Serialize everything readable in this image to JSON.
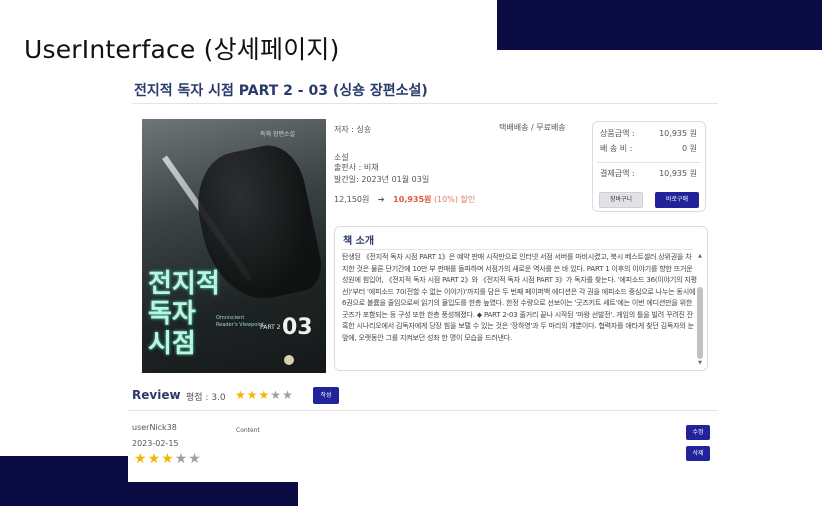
{
  "slide": {
    "title": "UserInterface (상세페이지)"
  },
  "book": {
    "title": "전지적 독자 시점 PART 2 - 03 (싱숑 장편소설)",
    "author_line": "저자 : 싱숑",
    "category": "소설",
    "publisher_line": "출판사 : 비채",
    "date_line": "발간일:  2023년 01월 03일",
    "shipping": "택배배송 / 무료배송",
    "original_price": "12,150원",
    "sale_price": "10,935원",
    "discount": "(10%) 할인"
  },
  "cover": {
    "top_text": "독해 장편소설",
    "title_lines": [
      "전지적",
      "독자",
      "시점"
    ],
    "english": "Omniscient Reader's Viewpoint",
    "part": "PART 2",
    "number": "03"
  },
  "summary": {
    "product_label": "상품금액 :",
    "product_value": "10,935 원",
    "shipping_label": "배 송 비 :",
    "shipping_value": "0 원",
    "total_label": "결제금액 :",
    "total_value": "10,935 원",
    "cart_button": "장바구니",
    "buy_button": "바로구매"
  },
  "intro": {
    "heading": "책 소개",
    "text": "탄생된 《전지적 독자 시점 PART 1》은 예약 판매 시작만으로 인터넷 서점 서버를 마비시켰고, 북시 베스트셀러 상위권을 차지한 것은 물론 단기간에 10만 부 판매를 돌파하며 서점가의 새로운 역사를 쓴 바 있다. PART 1 이후의 이야기를 향한 뜨거운 성원에 힘입어, 《전지적 독자 시점 PART 2》와 《전지적 독자 시점 PART 3》가 독자를 찾는다. '에피소드 36(이야기의 지평선)'부터 '에피소드 70(전할 수 없는 이야기)'까지를 담은 두 번째 페이퍼백 에디션은 각 권을 에피소드 중심으로 나누는 동시에 6권으로 볼륨을 줄임으로써 읽기의 몰입도를 한층 높였다. 한정 수량으로 선보이는 '굿즈키트 세트'에는 이번 에디션만을 위한 굿즈가 포함되는 등 구성 또한 한층 풍성해졌다. ◆ PART 2-03 줄거리 끝나 시작된 '마왕 선발전'. 게임의 틀을 빌려 꾸려진 잔혹한 시나리오에서 김독자에게 당장 힘을 보탤 수 있는 것은 '장하영'과 두 마리의 개뿐이다. 협력자를 애타게 찾던 김독자의 눈앞에, 오랫동안 그를 지켜보던 성좌 한 명이 모습을 드러낸다."
  },
  "review": {
    "heading": "Review",
    "score_label": "평점 : 3.0",
    "rating": 3,
    "max_rating": 5,
    "write_button": "작성",
    "items": [
      {
        "user": "userNick38",
        "date": "2023-02-15",
        "content": "Content",
        "rating": 3,
        "edit_button": "수정",
        "delete_button": "삭제"
      }
    ]
  },
  "colors": {
    "accent": "#22229a",
    "deco": "#0c0c44",
    "heading": "#2a3a6a",
    "sale": "#e05a3a",
    "star_on": "#f2b705",
    "star_off": "#a0a0a0"
  }
}
